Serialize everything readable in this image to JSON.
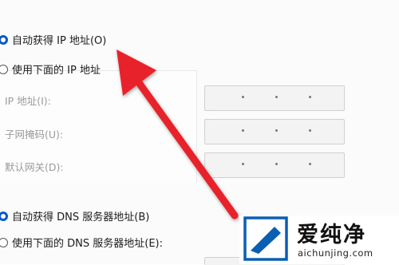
{
  "ip_section": {
    "auto_option": "自动获得 IP 地址(O)",
    "manual_option": "使用下面的 IP 地址",
    "fields": [
      {
        "label": "IP 地址(I):"
      },
      {
        "label": "子网掩码(U):"
      },
      {
        "label": "默认网关(D):"
      }
    ]
  },
  "dns_section": {
    "auto_option": "自动获得 DNS 服务器地址(B)",
    "manual_option": "使用下面的 DNS 服务器地址(E):"
  },
  "annotation": {
    "arrow_color": "#e8202a"
  },
  "watermark": {
    "brand_cn": "爱纯净",
    "brand_url": "aichunjing.com"
  },
  "colors": {
    "accent": "#0a59c7"
  }
}
